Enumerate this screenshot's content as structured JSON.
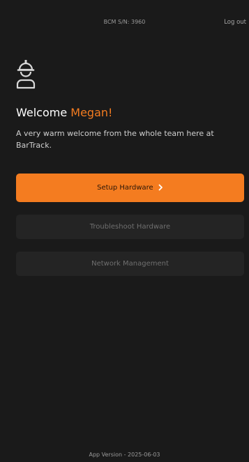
{
  "header": {
    "serial": "BCM S/N: 3960",
    "logout_label": "Log out"
  },
  "icons": {
    "worker": "construction-worker-icon",
    "chevron": "chevron-right-icon"
  },
  "welcome": {
    "greeting": "Welcome",
    "name": "Megan!",
    "message": "A very warm welcome from the whole team here at BarTrack."
  },
  "actions": {
    "setup_label": "Setup Hardware",
    "troubleshoot_label": "Troubleshoot Hardware",
    "network_label": "Network Management"
  },
  "footer": {
    "version": "App Version - 2025-06-03"
  },
  "colors": {
    "background": "#1a1a1a",
    "accent": "#f47c20",
    "secondary_button": "#242424",
    "muted_text": "#9a9a9a"
  }
}
